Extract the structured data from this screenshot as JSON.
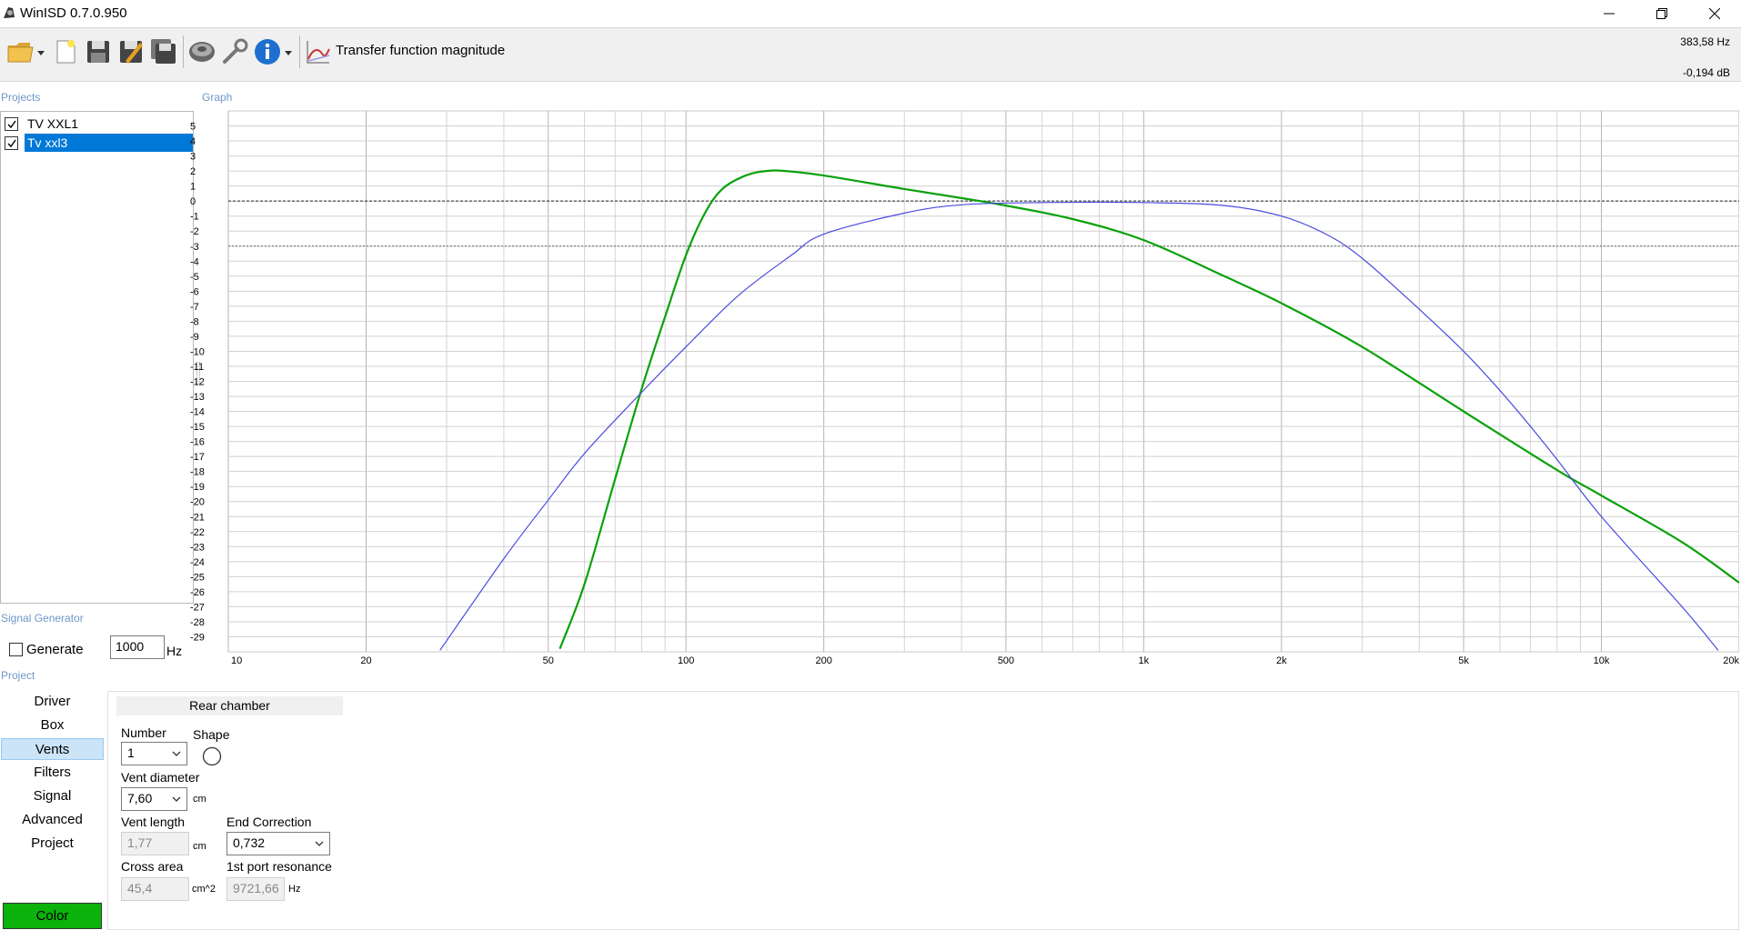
{
  "window": {
    "title": "WinISD 0.7.0.950"
  },
  "toolbar": {
    "icons": [
      "folder-open-icon",
      "new-document-icon",
      "save-icon",
      "save-as-icon",
      "save-all-icon",
      "speaker-icon",
      "wrench-icon",
      "info-icon",
      "graph-icon"
    ],
    "graph_type": "Transfer function magnitude",
    "cursor_freq": "383,58 Hz",
    "cursor_db": "-0,194 dB"
  },
  "projects": {
    "label": "Projects",
    "items": [
      {
        "name": "TV XXL1",
        "checked": true,
        "selected": false
      },
      {
        "name": "Tv xxl3",
        "checked": true,
        "selected": true
      }
    ]
  },
  "graph": {
    "label": "Graph"
  },
  "signal_generator": {
    "label": "Signal Generator",
    "generate_label": "Generate",
    "generate_checked": false,
    "frequency": "1000",
    "unit": "Hz"
  },
  "project_nav": {
    "label": "Project",
    "items": [
      "Driver",
      "Box",
      "Vents",
      "Filters",
      "Signal",
      "Advanced",
      "Project"
    ],
    "selected": "Vents",
    "color_button": "Color",
    "color_value": "#0bb20b"
  },
  "vents": {
    "rear_chamber_tab": "Rear chamber",
    "number_label": "Number",
    "number_value": "1",
    "shape_label": "Shape",
    "shape_value": "round-shape-icon",
    "vent_diameter_label": "Vent diameter",
    "vent_diameter_value": "7,60",
    "vent_diameter_unit": "cm",
    "vent_length_label": "Vent length",
    "vent_length_value": "1,77",
    "vent_length_unit": "cm",
    "end_correction_label": "End Correction",
    "end_correction_value": "0,732",
    "cross_area_label": "Cross area",
    "cross_area_value": "45,4",
    "cross_area_unit": "cm^2",
    "port_resonance_label": "1st port resonance",
    "port_resonance_value": "9721,66",
    "port_resonance_unit": "Hz"
  },
  "chart_data": {
    "type": "line",
    "title": "",
    "xlabel": "",
    "ylabel": "",
    "xscale": "log",
    "xlim": [
      10,
      20000
    ],
    "ylim": [
      -30,
      6
    ],
    "grid": true,
    "y_ticks": [
      5,
      4,
      3,
      2,
      1,
      0,
      -1,
      -2,
      -3,
      -4,
      -5,
      -6,
      -7,
      -8,
      -9,
      -10,
      -11,
      -12,
      -13,
      -14,
      -15,
      -16,
      -17,
      -18,
      -19,
      -20,
      -21,
      -22,
      -23,
      -24,
      -25,
      -26,
      -27,
      -28,
      -29
    ],
    "x_tick_labels": [
      {
        "value": 10,
        "label": "10"
      },
      {
        "value": 20,
        "label": "20"
      },
      {
        "value": 50,
        "label": "50"
      },
      {
        "value": 100,
        "label": "100"
      },
      {
        "value": 200,
        "label": "200"
      },
      {
        "value": 500,
        "label": "500"
      },
      {
        "value": 1000,
        "label": "1k"
      },
      {
        "value": 2000,
        "label": "2k"
      },
      {
        "value": 5000,
        "label": "5k"
      },
      {
        "value": 10000,
        "label": "10k"
      },
      {
        "value": 20000,
        "label": "20k"
      }
    ],
    "reference_lines": [
      {
        "y": 0,
        "style": "dotted"
      },
      {
        "y": -3,
        "style": "dotted"
      }
    ],
    "series": [
      {
        "color": "#0aa10a",
        "x": [
          53,
          60,
          70,
          80,
          90,
          100,
          110,
          120,
          135,
          150,
          165,
          200,
          300,
          400,
          500,
          700,
          1000,
          1500,
          2000,
          3000,
          5000,
          8000,
          10000,
          15000,
          20000
        ],
        "y": [
          -29.8,
          -25.5,
          -18.5,
          -12.5,
          -7.7,
          -3.6,
          -0.8,
          0.8,
          1.7,
          2.0,
          2.0,
          1.7,
          0.8,
          0.2,
          -0.3,
          -1.2,
          -2.6,
          -5.0,
          -6.8,
          -9.7,
          -14.0,
          -17.9,
          -19.6,
          -22.7,
          -25.4
        ]
      },
      {
        "color": "#4a4ae0",
        "x": [
          29,
          40,
          50,
          60,
          79,
          100,
          130,
          170,
          200,
          300,
          400,
          600,
          1000,
          1500,
          2000,
          2500,
          3000,
          4000,
          5000,
          6000,
          7000,
          8000,
          10000,
          15000,
          18000
        ],
        "y": [
          -29.9,
          -23.8,
          -19.9,
          -16.8,
          -12.9,
          -9.7,
          -6.3,
          -3.6,
          -2.2,
          -0.8,
          -0.25,
          -0.1,
          -0.1,
          -0.3,
          -1.0,
          -2.2,
          -3.8,
          -7.2,
          -10.0,
          -12.6,
          -15.0,
          -17.2,
          -21.0,
          -27.0,
          -29.9
        ]
      }
    ]
  }
}
